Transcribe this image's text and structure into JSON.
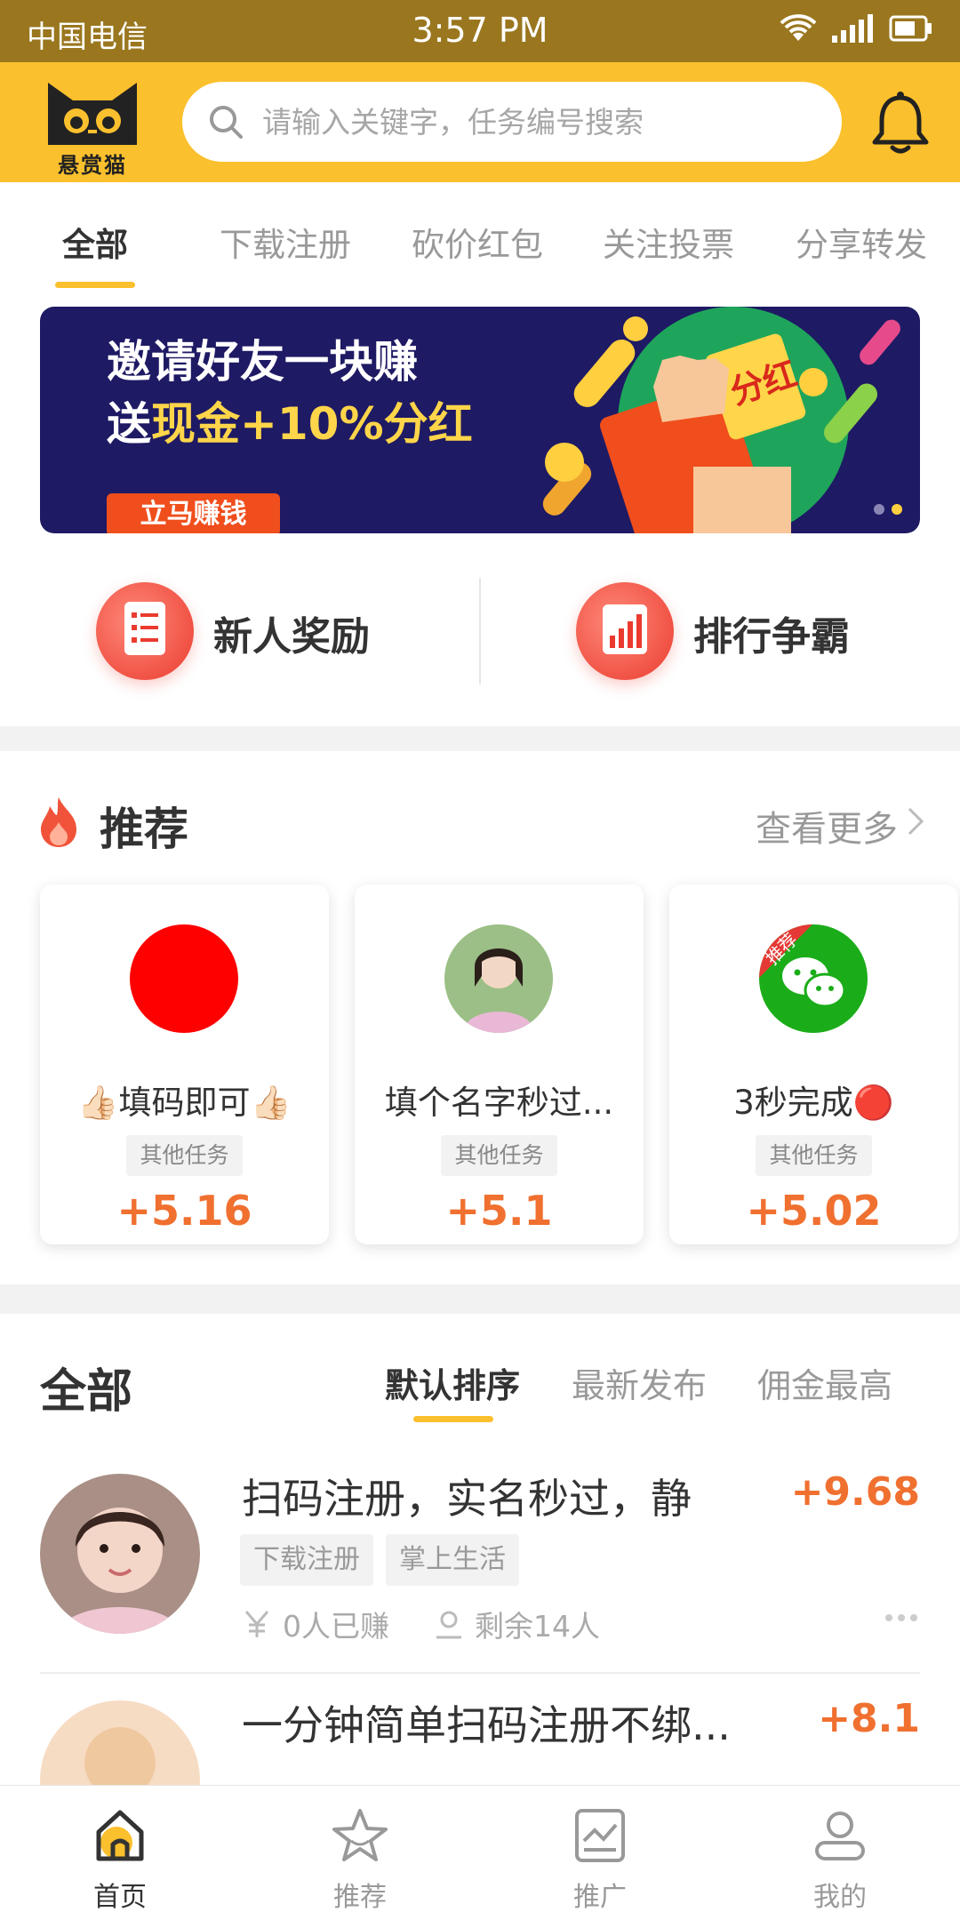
{
  "status_bar": {
    "carrier": "中国电信",
    "time": "3:57 PM"
  },
  "header": {
    "logo_text": "悬赏猫",
    "search_placeholder": "请输入关键字，任务编号搜索"
  },
  "category_tabs": [
    {
      "label": "全部",
      "active": true
    },
    {
      "label": "下载注册",
      "active": false
    },
    {
      "label": "砍价红包",
      "active": false
    },
    {
      "label": "关注投票",
      "active": false
    },
    {
      "label": "分享转发",
      "active": false
    }
  ],
  "banner": {
    "line1": "邀请好友一块赚",
    "line2_prefix": "送",
    "line2_highlight": "现金+10%分红",
    "badge_text": "分红",
    "button": "立马赚钱",
    "page_count": 2,
    "active_page": 2
  },
  "quick_links": [
    {
      "label": "新人奖励",
      "icon": "document-list-icon"
    },
    {
      "label": "排行争霸",
      "icon": "ranking-chart-icon"
    }
  ],
  "recommend": {
    "title": "推荐",
    "more": "查看更多",
    "cards": [
      {
        "name": "👍🏻填码即可👍🏻",
        "tag": "其他任务",
        "price": "+5.16",
        "avatar": "red-circle"
      },
      {
        "name": "填个名字秒过...",
        "tag": "其他任务",
        "price": "+5.1",
        "avatar": "girl-photo"
      },
      {
        "name": "3秒完成🔴",
        "tag": "其他任务",
        "price": "+5.02",
        "avatar": "wechat-logo",
        "corner_badge": "推荐"
      }
    ]
  },
  "all_tasks": {
    "title": "全部",
    "sort_options": [
      {
        "label": "默认排序",
        "active": true
      },
      {
        "label": "最新发布",
        "active": false
      },
      {
        "label": "佣金最高",
        "active": false
      }
    ],
    "items": [
      {
        "title": "扫码注册，实名秒过，静",
        "price": "+9.68",
        "tags": [
          "下载注册",
          "掌上生活"
        ],
        "earned": "0人已赚",
        "remaining": "剩余14人"
      },
      {
        "title": "一分钟简单扫码注册不绑...",
        "price": "+8.1"
      }
    ]
  },
  "bottom_nav": [
    {
      "label": "首页",
      "icon": "home-icon",
      "active": true
    },
    {
      "label": "推荐",
      "icon": "star-icon",
      "active": false
    },
    {
      "label": "推广",
      "icon": "chart-icon",
      "active": false
    },
    {
      "label": "我的",
      "icon": "user-icon",
      "active": false
    }
  ]
}
